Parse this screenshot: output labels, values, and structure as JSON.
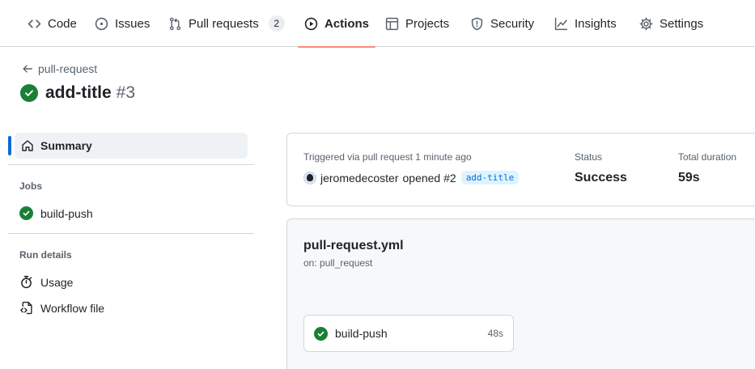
{
  "nav": {
    "tabs": [
      {
        "label": "Code",
        "icon": "code-icon"
      },
      {
        "label": "Issues",
        "icon": "issue-opened-icon"
      },
      {
        "label": "Pull requests",
        "icon": "git-pull-request-icon",
        "count": "2"
      },
      {
        "label": "Actions",
        "icon": "play-icon",
        "active": true
      },
      {
        "label": "Projects",
        "icon": "table-icon"
      },
      {
        "label": "Security",
        "icon": "shield-icon"
      },
      {
        "label": "Insights",
        "icon": "graph-icon"
      },
      {
        "label": "Settings",
        "icon": "gear-icon"
      }
    ],
    "active_underline_color": "#fd8c73"
  },
  "header": {
    "back_label": "pull-request",
    "run_name": "add-title",
    "run_number": "#3",
    "status_color": "#1a7f37"
  },
  "sidebar": {
    "summary_label": "Summary",
    "jobs_heading": "Jobs",
    "jobs": [
      {
        "label": "build-push",
        "status": "success"
      }
    ],
    "run_details_heading": "Run details",
    "run_details": [
      {
        "label": "Usage",
        "icon": "stopwatch-icon"
      },
      {
        "label": "Workflow file",
        "icon": "file-code-icon"
      }
    ],
    "accent_color": "#0969da"
  },
  "summary": {
    "trigger_label": "Triggered via pull request 1 minute ago",
    "actor": "jeromedecoster",
    "action": "opened #2",
    "branch": "add-title",
    "status_label": "Status",
    "status_value": "Success",
    "duration_label": "Total duration",
    "duration_value": "59s"
  },
  "workflow": {
    "file_name": "pull-request.yml",
    "trigger": "on: pull_request",
    "job": {
      "label": "build-push",
      "duration": "48s",
      "status": "success"
    }
  }
}
